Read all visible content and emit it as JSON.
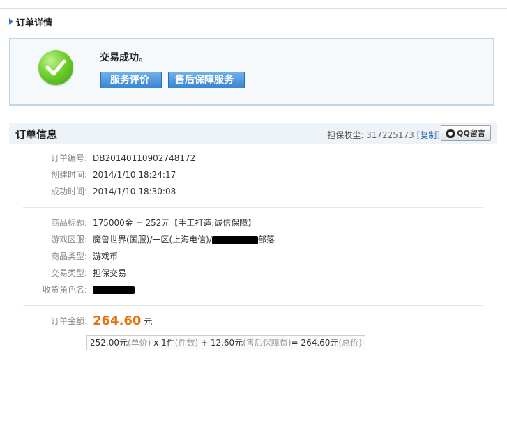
{
  "header": {
    "title": "订单详情"
  },
  "status": {
    "message": "交易成功。",
    "review_button": "服务评价",
    "after_sales_button": "售后保障服务"
  },
  "order_info": {
    "title": "订单信息",
    "guarantor_label": "担保牧尘:",
    "guarantor_id": "317225173",
    "copy_link": "[复制]",
    "qq_button": "QQ留言"
  },
  "details": {
    "order_no_label": "订单编号:",
    "order_no": "DB20140110902748172",
    "created_label": "创建时间:",
    "created": "2014/1/10 18:24:17",
    "success_label": "成功时间:",
    "success_time": "2014/1/10 18:30:08",
    "product_title_label": "商品标题:",
    "product_title": "175000金 = 252元【手工打造,诚信保障】",
    "server_label": "游戏区服:",
    "server_prefix": "魔兽世界(国服)/一区(上海电信)/",
    "server_suffix": "部落",
    "category_label": "商品类型:",
    "category": "游戏币",
    "trade_type_label": "交易类型:",
    "trade_type": "担保交易",
    "receiver_label": "收货角色名:",
    "amount_label": "订单金额:",
    "amount": "264.60",
    "amount_unit": "元"
  },
  "breakdown": {
    "unit_price": "252.00元",
    "unit_price_note": "(单价)",
    "qty": " x 1件",
    "qty_note": "(件数)",
    "fee": "+ 12.60元",
    "fee_note": "(售后保障费)",
    "total": "= 264.60元",
    "total_note": "(总价)"
  },
  "colors": {
    "accent_blue": "#3a86d2",
    "amount_orange": "#e8720c"
  }
}
